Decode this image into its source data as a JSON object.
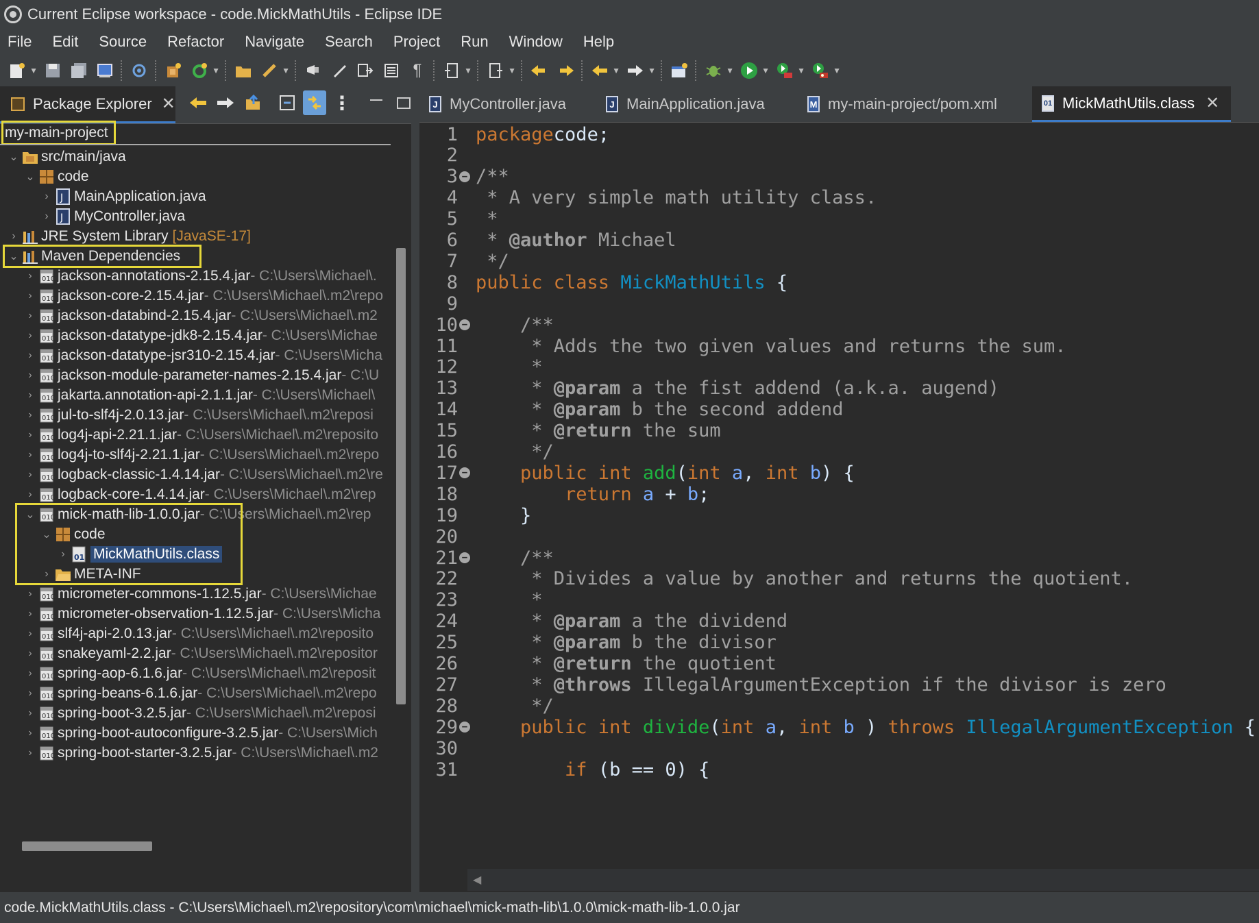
{
  "window": {
    "title": "Current Eclipse workspace - code.MickMathUtils - Eclipse IDE"
  },
  "menu": [
    "File",
    "Edit",
    "Source",
    "Refactor",
    "Navigate",
    "Search",
    "Project",
    "Run",
    "Window",
    "Help"
  ],
  "explorer": {
    "tab_label": "Package Explorer",
    "project": "my-main-project",
    "src_folder": "src/main/java",
    "package_code": "code",
    "files": [
      "MainApplication.java",
      "MyController.java"
    ],
    "jre": {
      "label": "JRE System Library",
      "decoration": "[JavaSE-17]"
    },
    "maven": "Maven Dependencies",
    "jars_before": [
      {
        "name": "jackson-annotations-2.15.4.jar",
        "path": " - C:\\Users\\Michael\\."
      },
      {
        "name": "jackson-core-2.15.4.jar",
        "path": " - C:\\Users\\Michael\\.m2\\repo"
      },
      {
        "name": "jackson-databind-2.15.4.jar",
        "path": " - C:\\Users\\Michael\\.m2"
      },
      {
        "name": "jackson-datatype-jdk8-2.15.4.jar",
        "path": " - C:\\Users\\Michae"
      },
      {
        "name": "jackson-datatype-jsr310-2.15.4.jar",
        "path": " - C:\\Users\\Micha"
      },
      {
        "name": "jackson-module-parameter-names-2.15.4.jar",
        "path": " - C:\\U"
      },
      {
        "name": "jakarta.annotation-api-2.1.1.jar",
        "path": " - C:\\Users\\Michael\\"
      },
      {
        "name": "jul-to-slf4j-2.0.13.jar",
        "path": " - C:\\Users\\Michael\\.m2\\reposi"
      },
      {
        "name": "log4j-api-2.21.1.jar",
        "path": " - C:\\Users\\Michael\\.m2\\reposito"
      },
      {
        "name": "log4j-to-slf4j-2.21.1.jar",
        "path": " - C:\\Users\\Michael\\.m2\\repo"
      },
      {
        "name": "logback-classic-1.4.14.jar",
        "path": " - C:\\Users\\Michael\\.m2\\re"
      },
      {
        "name": "logback-core-1.4.14.jar",
        "path": " - C:\\Users\\Michael\\.m2\\rep"
      }
    ],
    "mick_jar": {
      "name": "mick-math-lib-1.0.0.jar",
      "path": " - C:\\Users\\Michael\\.m2\\rep"
    },
    "mick_pkg": "code",
    "mick_class": "MickMathUtils.class",
    "meta_inf": "META-INF",
    "jars_after": [
      {
        "name": "micrometer-commons-1.12.5.jar",
        "path": " - C:\\Users\\Michae"
      },
      {
        "name": "micrometer-observation-1.12.5.jar",
        "path": " - C:\\Users\\Micha"
      },
      {
        "name": "slf4j-api-2.0.13.jar",
        "path": " - C:\\Users\\Michael\\.m2\\reposito"
      },
      {
        "name": "snakeyaml-2.2.jar",
        "path": " - C:\\Users\\Michael\\.m2\\repositor"
      },
      {
        "name": "spring-aop-6.1.6.jar",
        "path": " - C:\\Users\\Michael\\.m2\\reposit"
      },
      {
        "name": "spring-beans-6.1.6.jar",
        "path": " - C:\\Users\\Michael\\.m2\\repo"
      },
      {
        "name": "spring-boot-3.2.5.jar",
        "path": " - C:\\Users\\Michael\\.m2\\reposi"
      },
      {
        "name": "spring-boot-autoconfigure-3.2.5.jar",
        "path": " - C:\\Users\\Mich"
      },
      {
        "name": "spring-boot-starter-3.2.5.jar",
        "path": " - C:\\Users\\Michael\\.m2"
      }
    ]
  },
  "editor": {
    "tabs": [
      {
        "label": "MyController.java",
        "icon": "J"
      },
      {
        "label": "MainApplication.java",
        "icon": "J"
      },
      {
        "label": "my-main-project/pom.xml",
        "icon": "M"
      },
      {
        "label": "MickMathUtils.class",
        "icon": "01"
      }
    ],
    "active_tab": 3,
    "lines": [
      {
        "n": "1",
        "fold": false,
        "tokens": [
          [
            "kw",
            "package"
          ],
          [
            "",
            "code;"
          ]
        ]
      },
      {
        "n": "2",
        "fold": false,
        "tokens": []
      },
      {
        "n": "3",
        "fold": true,
        "tokens": [
          [
            "cm",
            "/**"
          ]
        ]
      },
      {
        "n": "4",
        "fold": false,
        "tokens": [
          [
            "cm",
            " * A very simple math utility class."
          ]
        ]
      },
      {
        "n": "5",
        "fold": false,
        "tokens": [
          [
            "cm",
            " *"
          ]
        ]
      },
      {
        "n": "6",
        "fold": false,
        "tokens": [
          [
            "cm",
            " * "
          ],
          [
            "tag",
            "@author"
          ],
          [
            "cm",
            " Michael"
          ]
        ]
      },
      {
        "n": "7",
        "fold": false,
        "tokens": [
          [
            "cm",
            " */"
          ]
        ]
      },
      {
        "n": "8",
        "fold": false,
        "tokens": [
          [
            "kw",
            "public class "
          ],
          [
            "typ",
            "MickMathUtils"
          ],
          [
            "",
            " {"
          ]
        ]
      },
      {
        "n": "9",
        "fold": false,
        "tokens": []
      },
      {
        "n": "10",
        "fold": true,
        "tokens": [
          [
            "cm",
            "    /**"
          ]
        ]
      },
      {
        "n": "11",
        "fold": false,
        "tokens": [
          [
            "cm",
            "     * Adds the two given values and returns the sum."
          ]
        ]
      },
      {
        "n": "12",
        "fold": false,
        "tokens": [
          [
            "cm",
            "     *"
          ]
        ]
      },
      {
        "n": "13",
        "fold": false,
        "tokens": [
          [
            "cm",
            "     * "
          ],
          [
            "tag",
            "@param"
          ],
          [
            "cm",
            " a the fist addend (a.k.a. augend)"
          ]
        ]
      },
      {
        "n": "14",
        "fold": false,
        "tokens": [
          [
            "cm",
            "     * "
          ],
          [
            "tag",
            "@param"
          ],
          [
            "cm",
            " b the second addend"
          ]
        ]
      },
      {
        "n": "15",
        "fold": false,
        "tokens": [
          [
            "cm",
            "     * "
          ],
          [
            "tag",
            "@return"
          ],
          [
            "cm",
            " the sum"
          ]
        ]
      },
      {
        "n": "16",
        "fold": false,
        "tokens": [
          [
            "cm",
            "     */"
          ]
        ]
      },
      {
        "n": "17",
        "fold": true,
        "tokens": [
          [
            "kw",
            "    public int "
          ],
          [
            "mth",
            "add"
          ],
          [
            "",
            "("
          ],
          [
            "kw",
            "int "
          ],
          [
            "var",
            "a"
          ],
          [
            "",
            ", "
          ],
          [
            "kw",
            "int "
          ],
          [
            "var",
            "b"
          ],
          [
            "",
            ") {"
          ]
        ]
      },
      {
        "n": "18",
        "fold": false,
        "tokens": [
          [
            "kw",
            "        return "
          ],
          [
            "var",
            "a"
          ],
          [
            "",
            " + "
          ],
          [
            "var",
            "b"
          ],
          [
            "",
            ";"
          ]
        ]
      },
      {
        "n": "19",
        "fold": false,
        "tokens": [
          [
            "",
            "    }"
          ]
        ]
      },
      {
        "n": "20",
        "fold": false,
        "tokens": []
      },
      {
        "n": "21",
        "fold": true,
        "tokens": [
          [
            "cm",
            "    /**"
          ]
        ]
      },
      {
        "n": "22",
        "fold": false,
        "tokens": [
          [
            "cm",
            "     * Divides a value by another and returns the quotient."
          ]
        ]
      },
      {
        "n": "23",
        "fold": false,
        "tokens": [
          [
            "cm",
            "     *"
          ]
        ]
      },
      {
        "n": "24",
        "fold": false,
        "tokens": [
          [
            "cm",
            "     * "
          ],
          [
            "tag",
            "@param"
          ],
          [
            "cm",
            " a the dividend"
          ]
        ]
      },
      {
        "n": "25",
        "fold": false,
        "tokens": [
          [
            "cm",
            "     * "
          ],
          [
            "tag",
            "@param"
          ],
          [
            "cm",
            " b the divisor"
          ]
        ]
      },
      {
        "n": "26",
        "fold": false,
        "tokens": [
          [
            "cm",
            "     * "
          ],
          [
            "tag",
            "@return"
          ],
          [
            "cm",
            " the quotient"
          ]
        ]
      },
      {
        "n": "27",
        "fold": false,
        "tokens": [
          [
            "cm",
            "     * "
          ],
          [
            "tag",
            "@throws"
          ],
          [
            "cm",
            " IllegalArgumentException if the divisor is zero"
          ]
        ]
      },
      {
        "n": "28",
        "fold": false,
        "tokens": [
          [
            "cm",
            "     */"
          ]
        ]
      },
      {
        "n": "29",
        "fold": true,
        "tokens": [
          [
            "kw",
            "    public int "
          ],
          [
            "mth",
            "divide"
          ],
          [
            "",
            "("
          ],
          [
            "kw",
            "int "
          ],
          [
            "var",
            "a"
          ],
          [
            "",
            ", "
          ],
          [
            "kw",
            "int "
          ],
          [
            "var",
            "b"
          ],
          [
            "",
            " ) "
          ],
          [
            "kw",
            "throws "
          ],
          [
            "typ",
            "IllegalArgumentException"
          ],
          [
            "",
            " {"
          ]
        ]
      },
      {
        "n": "30",
        "fold": false,
        "tokens": []
      },
      {
        "n": "31",
        "fold": false,
        "tokens": [
          [
            "kw",
            "        if "
          ],
          [
            "",
            "(b == 0) {"
          ]
        ]
      }
    ]
  },
  "statusbar": {
    "text": "code.MickMathUtils.class - C:\\Users\\Michael\\.m2\\repository\\com\\michael\\mick-math-lib\\1.0.0\\mick-math-lib-1.0.0.jar"
  },
  "colors": {
    "highlight": "#e6d83a",
    "accent": "#3d7cc9",
    "keyword": "#cc7832",
    "type": "#1290c3"
  }
}
